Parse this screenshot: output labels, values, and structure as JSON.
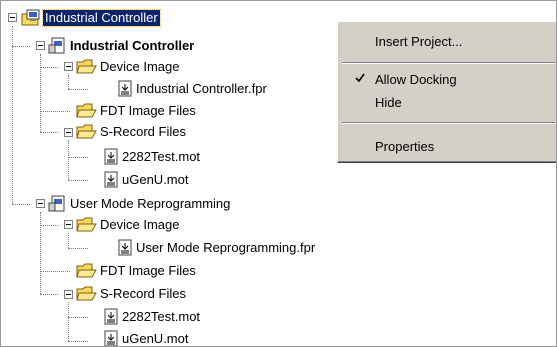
{
  "tree": {
    "root": {
      "label": "Industrial Controller",
      "selected": true
    },
    "project1": {
      "label": "Industrial Controller",
      "device_image": {
        "label": "Device Image",
        "file": "Industrial Controller.fpr"
      },
      "fdt_image_files": {
        "label": "FDT Image Files"
      },
      "srecord_files": {
        "label": "S-Record Files",
        "files": [
          "2282Test.mot",
          "uGenU.mot"
        ]
      }
    },
    "project2": {
      "label": "User Mode Reprogramming",
      "device_image": {
        "label": "Device Image",
        "file": "User Mode Reprogramming.fpr"
      },
      "fdt_image_files": {
        "label": "FDT Image Files"
      },
      "srecord_files": {
        "label": "S-Record Files",
        "files": [
          "2282Test.mot",
          "uGenU.mot"
        ]
      }
    }
  },
  "context_menu": {
    "items": [
      {
        "label": "Insert Project...",
        "checked": false
      },
      {
        "label": "Allow Docking",
        "checked": true
      },
      {
        "label": "Hide",
        "checked": false
      },
      {
        "label": "Properties",
        "checked": false
      }
    ]
  },
  "colors": {
    "selection": "#0a246a",
    "menu_bg": "#d4d0c8",
    "folder_yellow": "#f8d860"
  }
}
